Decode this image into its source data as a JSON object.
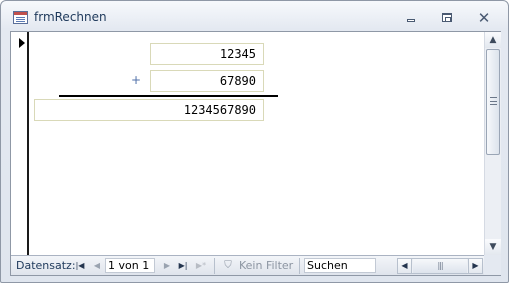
{
  "window": {
    "title": "frmRechnen",
    "close_glyph": "✕"
  },
  "form": {
    "field1_value": "12345",
    "operator": "+",
    "field2_value": "67890",
    "result_value": "1234567890"
  },
  "navigation": {
    "label": "Datensatz:",
    "first_glyph": "|◀",
    "prev_glyph": "◀",
    "record_position": "1 von 1",
    "next_glyph": "▶",
    "last_glyph": "▶|",
    "new_glyph": "▶*",
    "filter_icon": "funnel-x-icon",
    "filter_label": "Kein Filter",
    "search_placeholder": "Suchen"
  },
  "scrollbars": {
    "up_glyph": "▲",
    "down_glyph": "▼",
    "left_glyph": "◀",
    "right_glyph": "▶",
    "thumb_grip": "|||"
  },
  "colors": {
    "accent": "#1e395b",
    "field_border": "#d9d9b8",
    "operator_color": "#4f6fa8"
  }
}
